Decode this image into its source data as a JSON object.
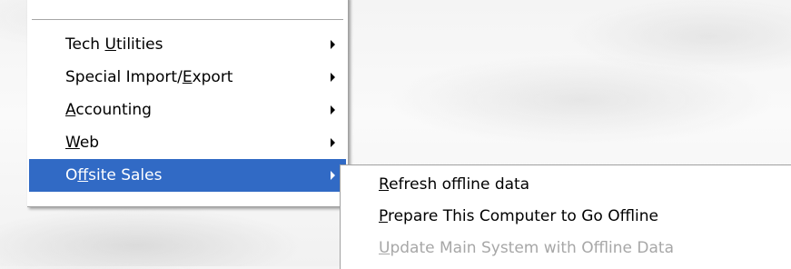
{
  "main_menu": {
    "items": [
      {
        "pre": "Tech ",
        "ul": "U",
        "post": "tilities"
      },
      {
        "pre": "Special Import/",
        "ul": "E",
        "post": "xport"
      },
      {
        "pre": "",
        "ul": "A",
        "post": "ccounting"
      },
      {
        "pre": "",
        "ul": "W",
        "post": "eb"
      },
      {
        "pre": "O",
        "ul": "f",
        "post": "fsite Sales"
      }
    ],
    "highlighted_index": 4,
    "highlight_color": "#316ac5"
  },
  "submenu": {
    "items": [
      {
        "pre": "",
        "ul": "R",
        "post": "efresh offline data",
        "enabled": true
      },
      {
        "pre": "",
        "ul": "P",
        "post": "repare This Computer to Go Offline",
        "enabled": true
      },
      {
        "pre": "",
        "ul": "U",
        "post": "pdate Main System with Offline Data",
        "enabled": false
      }
    ],
    "disabled_color": "#a7a7a7"
  }
}
